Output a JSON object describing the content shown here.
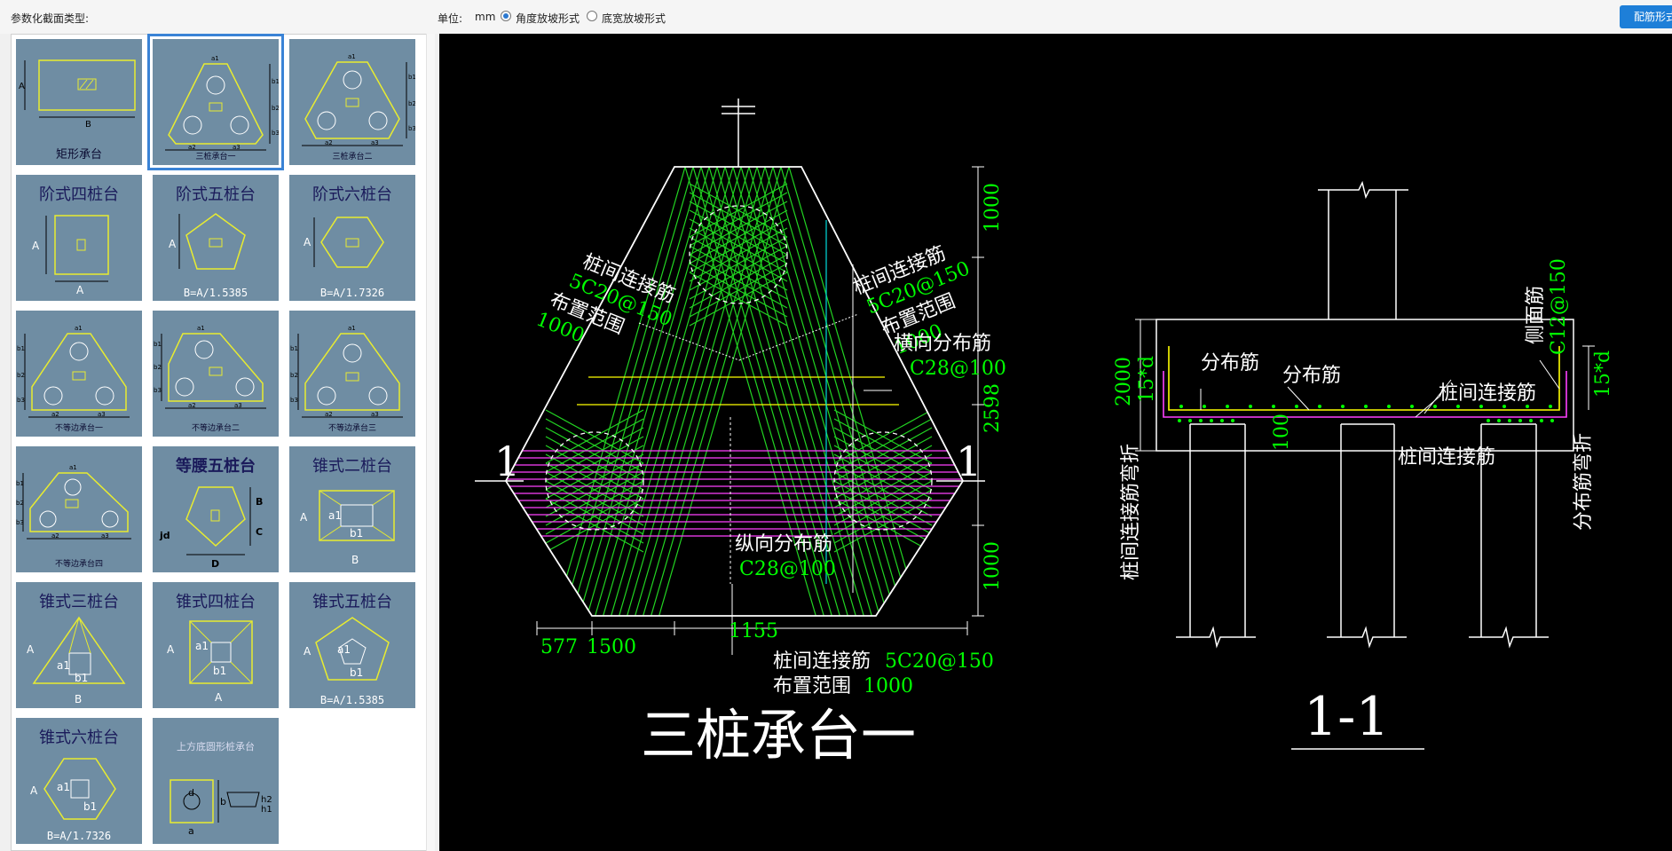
{
  "toolbar": {
    "section_type_label": "参数化截面类型:",
    "unit_label": "单位:",
    "unit_value": "mm",
    "slope_options": [
      {
        "label": "角度放坡形式",
        "selected": true
      },
      {
        "label": "底宽放坡形式",
        "selected": false
      }
    ],
    "action_button": "配筋形式"
  },
  "gallery": {
    "items": [
      {
        "title": "矩形承台",
        "dims": [
          "A",
          "B"
        ]
      },
      {
        "title": "三桩承台一",
        "selected": true,
        "dims": [
          "a1",
          "a2",
          "a3",
          "b1",
          "b2",
          "b3"
        ]
      },
      {
        "title": "三桩承台二",
        "dims": [
          "a1",
          "a2",
          "a3",
          "b1",
          "b2",
          "b3"
        ]
      },
      {
        "title": "阶式四桩台",
        "dims": [
          "A",
          "A"
        ]
      },
      {
        "title": "阶式五桩台",
        "dims": [
          "A"
        ],
        "formula": "B=A/1.5385"
      },
      {
        "title": "阶式六桩台",
        "dims": [
          "A"
        ],
        "formula": "B=A/1.7326"
      },
      {
        "title": "不等边承台一",
        "dims": [
          "a1",
          "a2",
          "a3",
          "b1",
          "b2",
          "b3"
        ]
      },
      {
        "title": "不等边承台二",
        "dims": [
          "a1",
          "a2",
          "a3",
          "b1",
          "b2",
          "b3"
        ]
      },
      {
        "title": "不等边承台三",
        "dims": [
          "a1",
          "a2",
          "a3",
          "b1",
          "b2",
          "b3"
        ]
      },
      {
        "title": "不等边承台四",
        "dims": [
          "a1",
          "a2",
          "a3",
          "b1",
          "b2",
          "b3"
        ]
      },
      {
        "title": "等腰五桩台",
        "dims": [
          "B",
          "C",
          "jd",
          "D"
        ]
      },
      {
        "title": "锥式二桩台",
        "dims": [
          "A",
          "a1",
          "b1",
          "B"
        ]
      },
      {
        "title": "锥式三桩台",
        "dims": [
          "A",
          "a1",
          "b1",
          "B"
        ]
      },
      {
        "title": "锥式四桩台",
        "dims": [
          "A",
          "a1",
          "b1",
          "A"
        ]
      },
      {
        "title": "锥式五桩台",
        "dims": [
          "A",
          "a1",
          "b1"
        ],
        "formula": "B=A/1.5385"
      },
      {
        "title": "锥式六桩台",
        "dims": [
          "A",
          "a1",
          "b1"
        ],
        "formula": "B=A/1.7326"
      },
      {
        "title": "上方底圆形桩承台",
        "dims": [
          "d",
          "b",
          "h2",
          "h1",
          "a"
        ]
      }
    ]
  },
  "drawing": {
    "plan": {
      "section_mark_left": "1",
      "section_mark_right": "1",
      "note_left": {
        "title": "桩间连接筋",
        "spec": "5C20@150",
        "range_label": "布置范围",
        "range": "1000"
      },
      "note_right": {
        "title": "桩间连接筋",
        "spec": "5C20@150",
        "range_label": "布置范围",
        "range": "1000"
      },
      "transverse": {
        "title": "横向分布筋",
        "spec": "C28@100"
      },
      "longitudinal": {
        "title": "纵向分布筋",
        "spec": "C28@100"
      },
      "note_bottom": {
        "title": "桩间连接筋",
        "spec": "5C20@150",
        "range_label": "布置范围",
        "range": "1000"
      },
      "dim_right": [
        "1000",
        "2598",
        "1000"
      ],
      "dim_bottom": [
        "577",
        "1500",
        "1155"
      ],
      "title": "三桩承台一"
    },
    "section": {
      "labels": {
        "dist1": "分布筋",
        "dist2": "分布筋",
        "side": "侧面筋",
        "side_spec": "C12@150",
        "connect": "桩间连接筋",
        "connect_bottom": "桩间连接筋",
        "bend_left": "桩间连接筋弯折",
        "bend_right": "分布筋弯折"
      },
      "dims": {
        "height": "2000",
        "hook_left": "15*d",
        "hook_right": "15*d",
        "embed": "100"
      },
      "title": "1-1"
    }
  },
  "colors": {
    "cad_bg": "#000000",
    "green_text": "#00ff00",
    "white_line": "#ffffff",
    "yellow": "#ffff00",
    "magenta": "#ff00ff",
    "cyan": "#00ffff",
    "thumb_bg": "#6f8da3",
    "accent": "#1e7fd8"
  }
}
